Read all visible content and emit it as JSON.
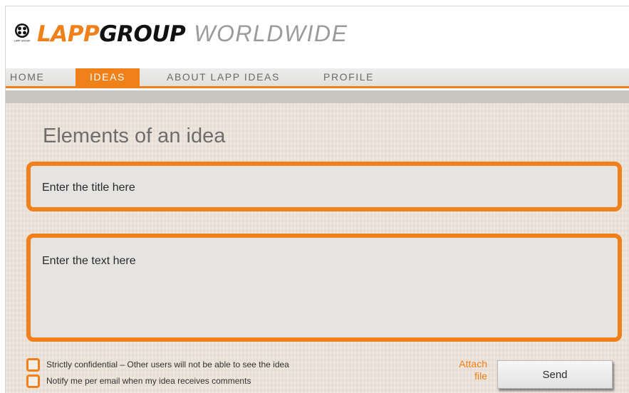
{
  "brand": {
    "name_part1": "LAPP",
    "name_part2": "GROUP",
    "name_part3": "WORLDWIDE",
    "logo_small_text": "LAPP GROUP",
    "accent_color": "#f08019"
  },
  "nav": {
    "items": [
      {
        "label": "HOME",
        "active": false
      },
      {
        "label": "IDEAS",
        "active": true
      },
      {
        "label": "ABOUT LAPP IDEAS",
        "active": false
      },
      {
        "label": "PROFILE",
        "active": false
      }
    ]
  },
  "main": {
    "title": "Elements of an idea",
    "title_field": {
      "placeholder": "Enter the title here"
    },
    "text_field": {
      "placeholder": "Enter the text here"
    },
    "options": [
      {
        "label": "Strictly confidential – Other users will not be able to see the idea",
        "checked": false
      },
      {
        "label": "Notify me per email when my idea receives comments",
        "checked": false
      }
    ],
    "attach_label": "Attach file",
    "send_label": "Send"
  }
}
